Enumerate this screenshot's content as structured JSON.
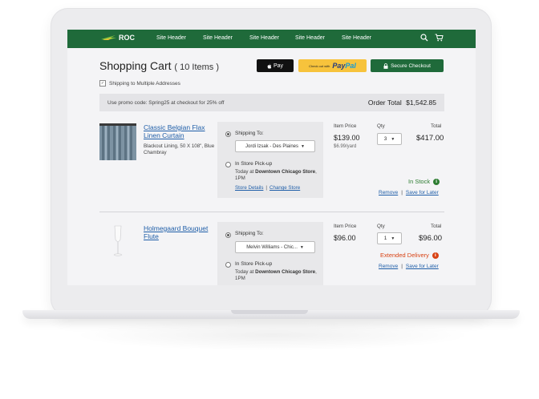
{
  "nav": {
    "logo_text": "ROC",
    "items": [
      "Site Header",
      "Site Header",
      "Site Header",
      "Site Header",
      "Site Header"
    ]
  },
  "cart": {
    "title": "Shopping Cart",
    "count_label": "( 10 Items )",
    "apple_pay_label": "Pay",
    "paypal_prefix": "Check out with",
    "paypal_brand_a": "Pay",
    "paypal_brand_b": "Pal",
    "secure_checkout_label": "Secure Checkout",
    "multi_address_label": "Shipping to Multiple Addresses",
    "multi_address_checked": true
  },
  "promo": {
    "text": "Use promo code: Spring25 at checkout for 25% off",
    "order_total_label": "Order Total",
    "order_total_value": "$1,542.85"
  },
  "labels": {
    "shipping_to": "Shipping To:",
    "in_store_pickup": "In Store Pick-up",
    "item_price": "Item Price",
    "qty": "Qty",
    "total": "Total",
    "remove": "Remove",
    "save_for_later": "Save for Later",
    "sep": "|"
  },
  "items": [
    {
      "name": "Classic Belgian Flax Linen Curtain",
      "description": "Blackout Lining, 50 X 108\", Blue Chambray",
      "ship_to": "Jordi Izsak - Des Plaines",
      "pickup_prefix": "Today at",
      "pickup_store": "Downtown Chicago Store",
      "pickup_time": ", 1PM",
      "store_details": "Store Details",
      "change_store": "Change Store",
      "price": "$139.00",
      "unit_price": "$6.99/yard",
      "qty": "3",
      "total": "$417.00",
      "status": "In Stock",
      "status_color": "#2e7d32"
    },
    {
      "name": "Holmegaard Bouquet Flute",
      "description": "",
      "ship_to": "Melvin Williams - Chic...",
      "pickup_prefix": "Today at",
      "pickup_store": "Downtown Chicago Store",
      "pickup_time": ", 1PM",
      "price": "$96.00",
      "qty": "1",
      "total": "$96.00",
      "status": "Extended Delivery",
      "status_color": "#d84315"
    }
  ],
  "colors": {
    "brand_green": "#1f6a3a",
    "paypal_yellow": "#f7c33c",
    "link_blue": "#1f5ea8"
  }
}
